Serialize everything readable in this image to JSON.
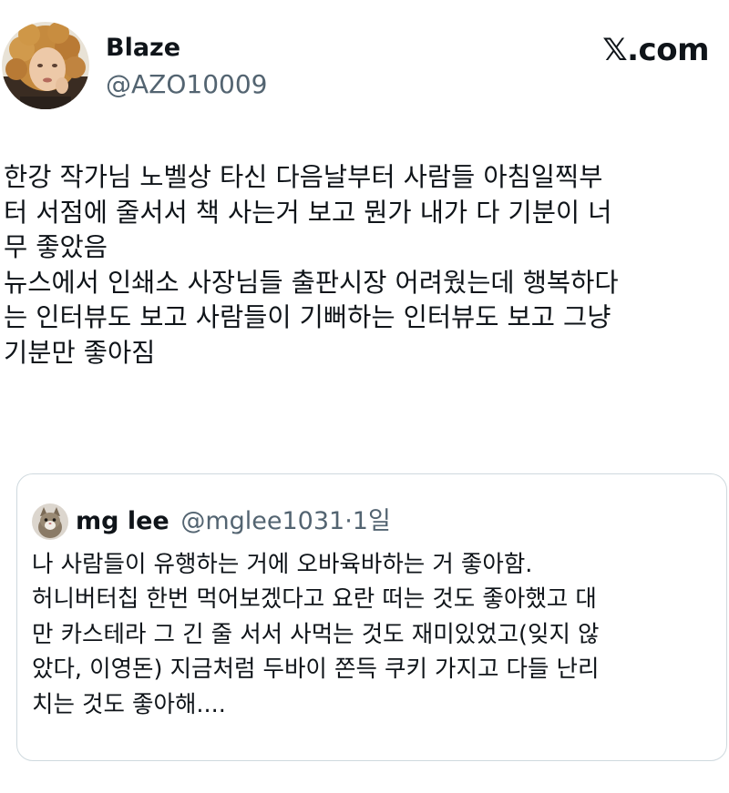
{
  "author": {
    "name": "Blaze",
    "handle": "@AZO10009",
    "avatar": "curly-haired-person-avatar"
  },
  "brand": "𝕏.com",
  "tweet_lines": [
    "한강 작가님 노벨상 타신 다음날부터 사람들 아침일찍부",
    "터 서점에 줄서서 책 사는거 보고 뭔가 내가 다 기분이 너",
    "무 좋았음",
    "뉴스에서 인쇄소 사장님들 출판시장 어려웠는데 행복하다",
    "는 인터뷰도 보고 사람들이 기뻐하는 인터뷰도 보고 그냥",
    "기분만 좋아짐"
  ],
  "quote": {
    "name": "mg lee",
    "meta": "@mglee1031·1일",
    "avatar": "cat-avatar",
    "lines": [
      "나 사람들이 유행하는 거에 오바육바하는 거 좋아함.",
      "허니버터칩 한번 먹어보겠다고 요란 떠는 것도 좋아했고 대",
      "만 카스테라 그 긴 줄 서서 사먹는 것도 재미있었고(잊지 않",
      "았다, 이영돈) 지금처럼 두바이 쫀득 쿠키 가지고 다들 난리",
      "치는 것도 좋아해...."
    ]
  },
  "colors": {
    "text": "#0f1419",
    "secondary": "#536471",
    "border": "#cfd9de"
  }
}
